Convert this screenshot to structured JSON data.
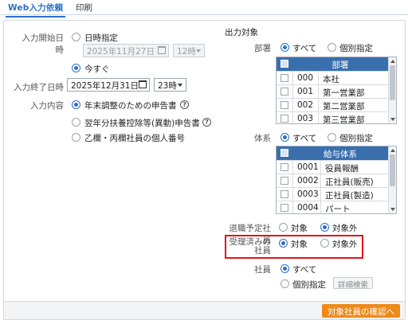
{
  "tabs": {
    "active": "Web入力依頼",
    "inactive": "印刷"
  },
  "input_start": {
    "label": "入力開始日時",
    "opt_specify": "日時指定",
    "date": "2025年11月27日",
    "hour": "12時",
    "opt_now": "今すぐ"
  },
  "input_end": {
    "label": "入力終了日時",
    "date": "2025年12月31日",
    "hour": "23時"
  },
  "input_content": {
    "label": "入力内容",
    "items": [
      {
        "label": "年末調整のための申告書",
        "help": "?"
      },
      {
        "label": "翌年分扶養控除等(異動)申告書",
        "help": "?"
      },
      {
        "label": "乙欄・丙欄社員の個人番号"
      }
    ]
  },
  "output": {
    "title": "出力対象",
    "dept": {
      "label": "部署",
      "opt_all": "すべて",
      "opt_specify": "個別指定",
      "header": "部署",
      "rows": [
        {
          "code": "000",
          "name": "本社"
        },
        {
          "code": "001",
          "name": "第一営業部"
        },
        {
          "code": "002",
          "name": "第二営業部"
        },
        {
          "code": "003",
          "name": "第三営業部"
        }
      ]
    },
    "system": {
      "label": "体系",
      "opt_all": "すべて",
      "opt_specify": "個別指定",
      "header": "給与体系",
      "rows": [
        {
          "code": "0001",
          "name": "役員報酬"
        },
        {
          "code": "0002",
          "name": "正社員(販売)"
        },
        {
          "code": "0003",
          "name": "正社員(製造)"
        },
        {
          "code": "0004",
          "name": "パート"
        }
      ]
    },
    "retire": {
      "label": "退職予定社員",
      "opt_target": "対象",
      "opt_exclude": "対象外"
    },
    "accepted": {
      "label_line1": "受理済みの",
      "label_line2": "社員",
      "opt_target": "対象",
      "opt_exclude": "対象外"
    },
    "employee": {
      "label": "社員",
      "opt_all": "すべて",
      "opt_specify": "個別指定",
      "detail_search": "詳細検索"
    }
  },
  "footer": {
    "confirm_button": "対象社員の確認へ"
  },
  "colors": {
    "accent": "#2d6fc6",
    "table_header": "#3a6fae",
    "primary_button": "#ee8a1a",
    "highlight": "#e3141a"
  }
}
